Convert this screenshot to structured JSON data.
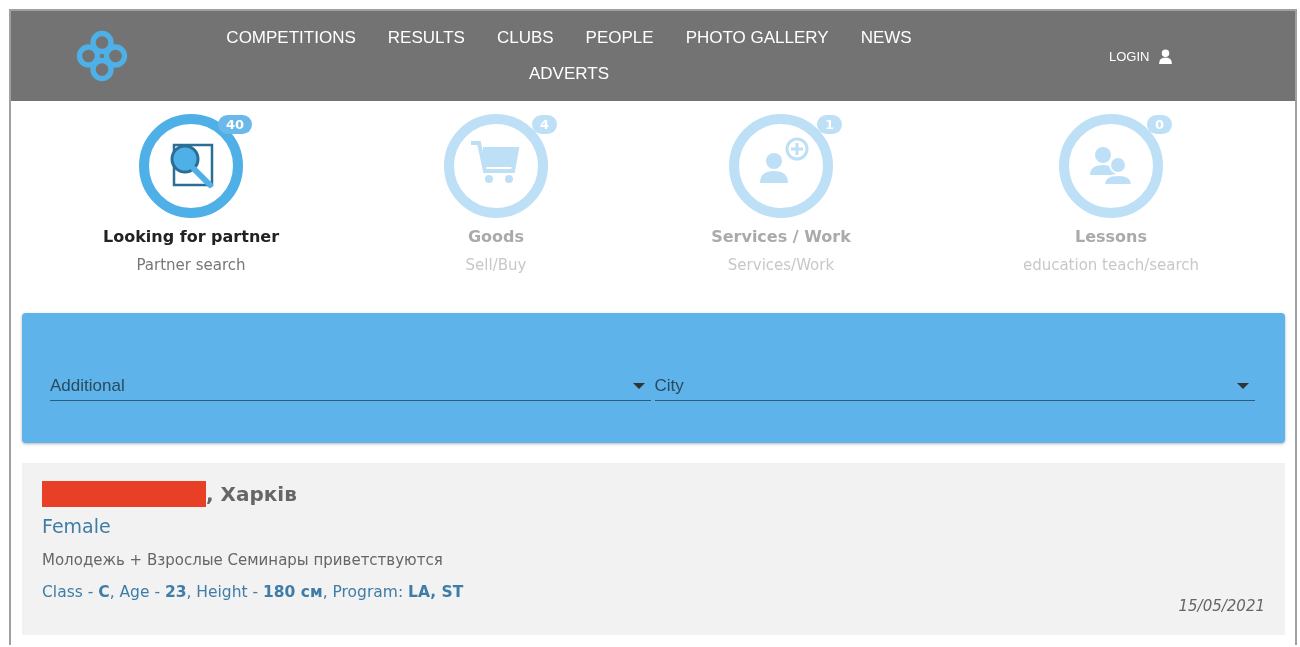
{
  "nav": {
    "items": [
      "COMPETITIONS",
      "RESULTS",
      "CLUBS",
      "PEOPLE",
      "PHOTO GALLERY",
      "NEWS",
      "ADVERTS"
    ],
    "login": "LOGIN"
  },
  "categories": [
    {
      "kind": "search",
      "count": "40",
      "title": "Looking for partner",
      "subtitle": "Partner search",
      "selected": true
    },
    {
      "kind": "cart",
      "count": "4",
      "title": "Goods",
      "subtitle": "Sell/Buy",
      "selected": false
    },
    {
      "kind": "person-add",
      "count": "1",
      "title": "Services / Work",
      "subtitle": "Services/Work",
      "selected": false
    },
    {
      "kind": "people",
      "count": "0",
      "title": "Lessons",
      "subtitle": "education teach/search",
      "selected": false
    }
  ],
  "filters": [
    {
      "value": "Additional"
    },
    {
      "value": "City"
    }
  ],
  "adverts": [
    {
      "name_redacted": true,
      "city": ", Харків",
      "gender": "Female",
      "description": "Молодежь + Взрослые Семинары приветствуются",
      "details": "Class - **C**, Age - **23**, Height - **180 см**, Program: **LA, ST**",
      "date": "15/05/2021"
    }
  ]
}
